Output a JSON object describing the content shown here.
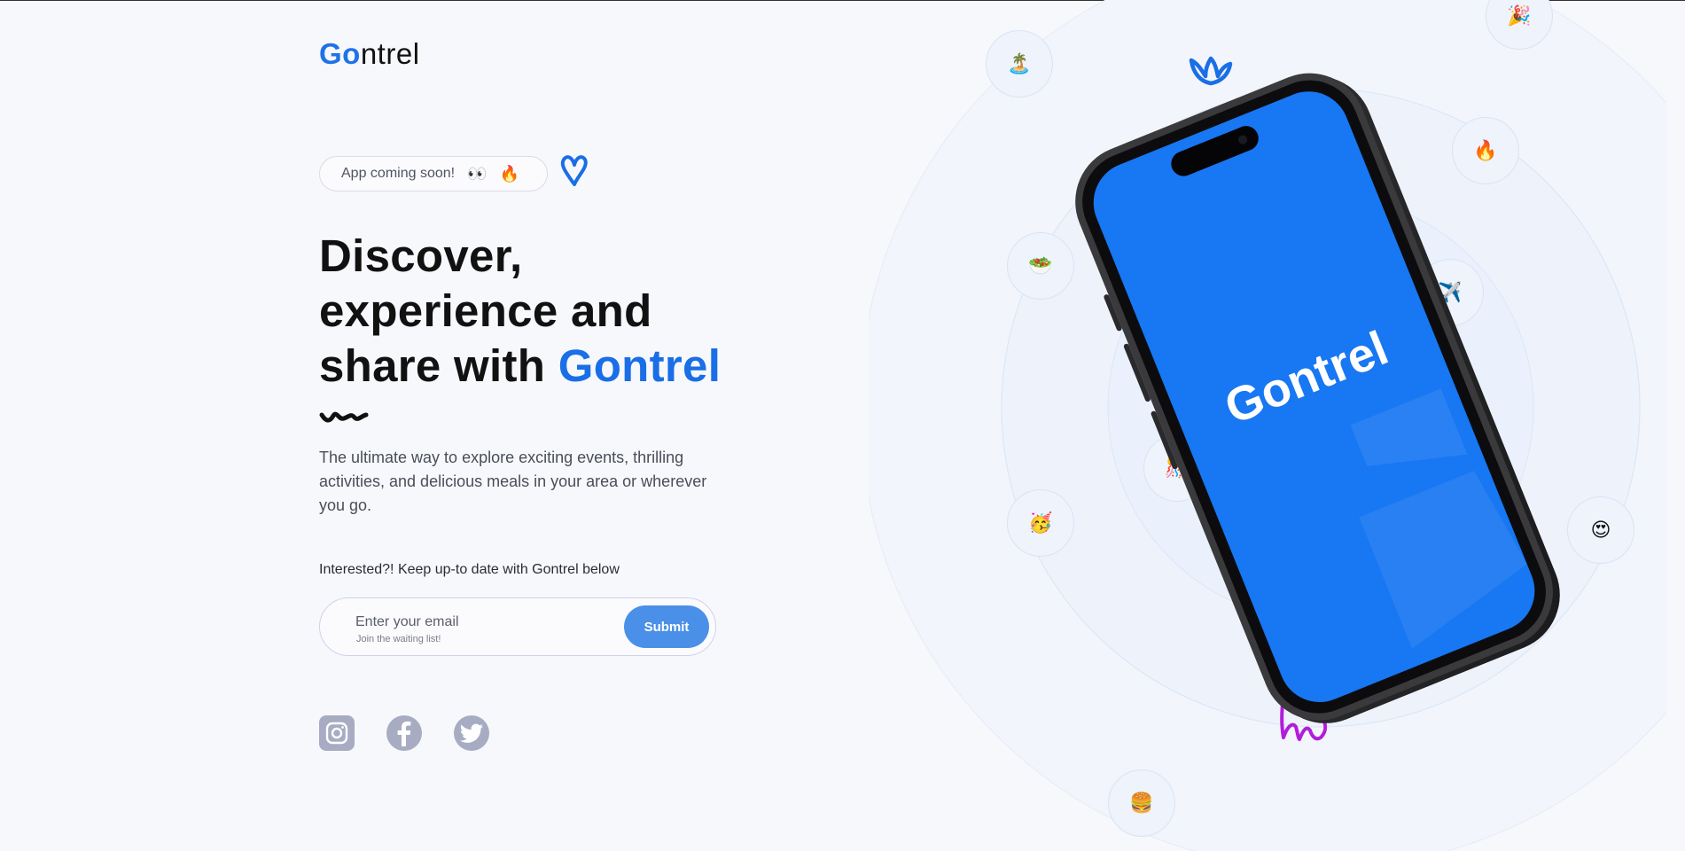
{
  "brand": {
    "logo_text_rest": "ntrel",
    "logo_g": "Go",
    "accent": "#1a6ee6"
  },
  "badge": {
    "label": "App coming soon!",
    "emoji_1": "👀",
    "emoji_2": "🔥"
  },
  "hero": {
    "line1": "Discover,",
    "line2": "experience and",
    "line3_prefix": "share with ",
    "line3_brand": "Gontrel",
    "description": "The ultimate way to explore exciting events, thrilling activities, and delicious meals in your area or wherever you go."
  },
  "signup": {
    "prompt": "Interested?! Keep up-to date with Gontrel below",
    "placeholder": "Enter your email",
    "hint": "Join the waiting list!",
    "submit_label": "Submit"
  },
  "social": [
    {
      "name": "instagram-icon"
    },
    {
      "name": "facebook-icon"
    },
    {
      "name": "twitter-icon"
    }
  ],
  "bubbles": [
    "🏝️",
    "🎉",
    "🔥",
    "🥗",
    "✈️",
    "🎊",
    "🥳",
    "😍",
    "🍔"
  ],
  "phone": {
    "screen_brand": "Gontrel",
    "screen_color": "#1877f2"
  }
}
